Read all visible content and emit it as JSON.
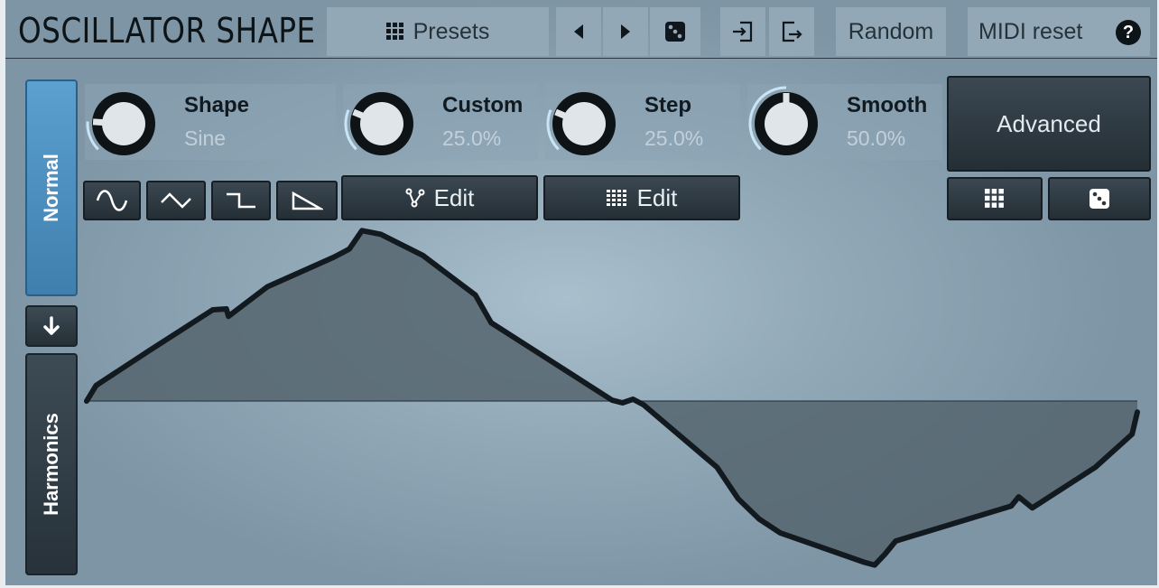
{
  "header": {
    "title": "OSCILLATOR SHAPE",
    "presets_label": "Presets",
    "random_label": "Random",
    "midi_reset_label": "MIDI reset",
    "help_label": "?"
  },
  "tabs": {
    "normal": "Normal",
    "harmonics": "Harmonics"
  },
  "knobs": [
    {
      "name": "Shape",
      "value": "Sine",
      "level": 0.18
    },
    {
      "name": "Custom",
      "value": "25.0%",
      "level": 0.25
    },
    {
      "name": "Step",
      "value": "25.0%",
      "level": 0.25
    },
    {
      "name": "Smooth",
      "value": "50.0%",
      "level": 0.5
    }
  ],
  "advanced_label": "Advanced",
  "edit_buttons": {
    "shape_edit": "Edit",
    "step_edit": "Edit"
  },
  "waveform": {
    "title": "",
    "baseline": 0,
    "points": [
      [
        0,
        0
      ],
      [
        0.009,
        0.17
      ],
      [
        0.06,
        0.55
      ],
      [
        0.12,
        0.99
      ],
      [
        0.133,
        1.0
      ],
      [
        0.135,
        0.92
      ],
      [
        0.172,
        1.24
      ],
      [
        0.235,
        1.56
      ],
      [
        0.25,
        1.65
      ],
      [
        0.262,
        1.85
      ],
      [
        0.28,
        1.81
      ],
      [
        0.32,
        1.58
      ],
      [
        0.37,
        1.15
      ],
      [
        0.385,
        0.85
      ],
      [
        0.5,
        0.01
      ],
      [
        0.51,
        -0.02
      ],
      [
        0.52,
        0.02
      ],
      [
        0.53,
        -0.04
      ],
      [
        0.6,
        -0.72
      ],
      [
        0.62,
        -1.06
      ],
      [
        0.64,
        -1.28
      ],
      [
        0.66,
        -1.43
      ],
      [
        0.74,
        -1.75
      ],
      [
        0.75,
        -1.78
      ],
      [
        0.76,
        -1.66
      ],
      [
        0.77,
        -1.52
      ],
      [
        0.88,
        -1.14
      ],
      [
        0.887,
        -1.04
      ],
      [
        0.9,
        -1.16
      ],
      [
        0.96,
        -0.72
      ],
      [
        0.995,
        -0.36
      ],
      [
        1.0,
        -0.12
      ]
    ]
  },
  "colors": {
    "accent": "#4a8fc2",
    "panel": "#93a8b6",
    "dark": "#2a353d",
    "fill": "#55656f"
  }
}
